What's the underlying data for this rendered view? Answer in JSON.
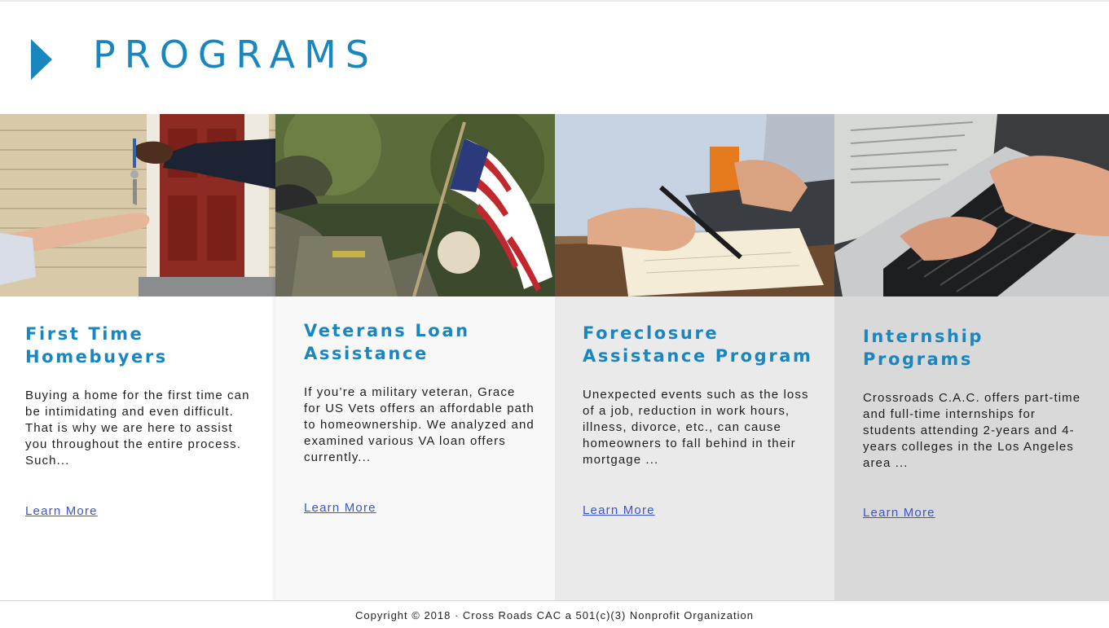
{
  "header": {
    "title": "PROGRAMS"
  },
  "programs": [
    {
      "title_line1": "First Time",
      "title_line2": "Homebuyers",
      "description": "Buying a home for the first time can be intimidating and even difficult. That is why we are here to assist you throughout the entire process. Such...",
      "link_label": "Learn More",
      "photo": "house-keys-handover-photo"
    },
    {
      "title_line1": "Veterans Loan",
      "title_line2": "Assistance",
      "description": "If you’re a military veteran, Grace for US Vets offers an affordable path to homeownership. We analyzed and examined various VA loan offers currently...",
      "link_label": "Learn More",
      "photo": "veteran-with-american-flag-photo"
    },
    {
      "title_line1": "Foreclosure",
      "title_line2": "Assistance Program",
      "description": "Unexpected events such as the loss of a job, reduction in work hours, illness, divorce, etc., can cause homeowners to fall behind in their mortgage ...",
      "link_label": "Learn More",
      "photo": "person-writing-notes-photo"
    },
    {
      "title_line1": "Internship",
      "title_line2": "Programs",
      "description": "Crossroads C.A.C. offers part-time and full-time internships for students attending 2-years and 4-years colleges in the Los Angeles area ...",
      "link_label": "Learn More",
      "photo": "hands-typing-laptop-photo"
    }
  ],
  "footer": {
    "copyright": "Copyright © 2018 · Cross Roads CAC a 501(c)(3) Nonprofit Organization"
  },
  "colors": {
    "accent": "#1a86c0",
    "link": "#3b55d0"
  }
}
